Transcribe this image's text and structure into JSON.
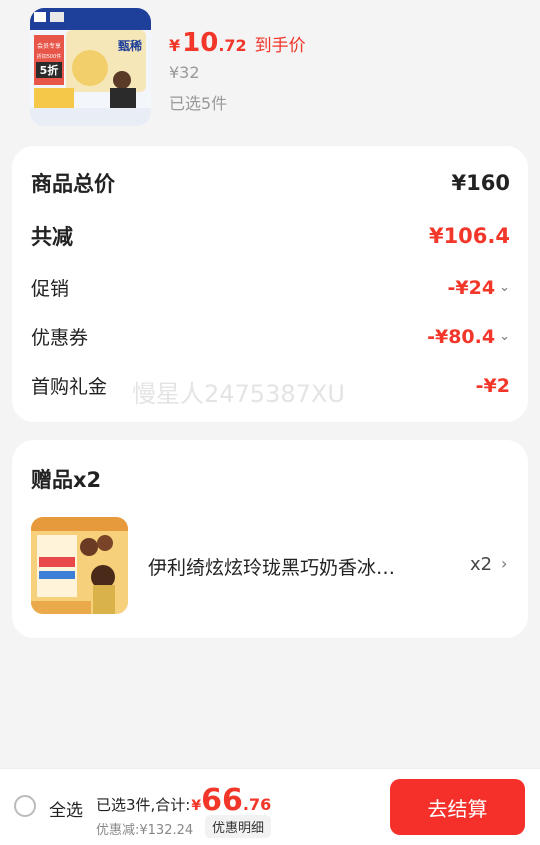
{
  "product": {
    "price_symbol": "¥",
    "price_int": "10",
    "price_dec": ".72",
    "price_tag": "到手价",
    "original_price": "¥32",
    "selected_count": "已选5件",
    "image": {
      "brand": "甄稀",
      "badge_top": "会员专享",
      "badge_mid": "折扣500件",
      "badge_main": "5折"
    }
  },
  "summary": {
    "total_label": "商品总价",
    "total_value": "¥160",
    "reduce_label": "共减",
    "reduce_value": "¥106.4",
    "promo_label": "促销",
    "promo_value": "-¥24",
    "coupon_label": "优惠券",
    "coupon_value": "-¥80.4",
    "gift_cash_label": "首购礼金",
    "gift_cash_value": "-¥2",
    "watermark": "慢星人2475387XU"
  },
  "gifts": {
    "title": "赠品x2",
    "item_name": "伊利绮炫炫玲珑黑巧奶香冰…",
    "item_qty": "x2"
  },
  "bottom_bar": {
    "select_all": "全选",
    "sum_text": "已选3件,合计:",
    "sum_symbol": "¥",
    "sum_int": "66",
    "sum_dec": ".76",
    "discount_text": "优惠减:¥132.24",
    "detail_label": "优惠明细",
    "checkout_label": "去结算"
  },
  "colors": {
    "accent_red": "#f2362a",
    "checkout_bg": "#f5302a",
    "page_bg": "#f4f4f4"
  },
  "icons": [
    "chevron-down-icon",
    "chevron-right-icon",
    "radio-unchecked-icon"
  ]
}
